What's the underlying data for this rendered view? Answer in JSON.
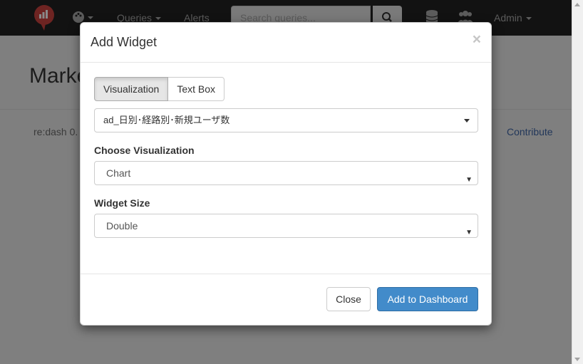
{
  "navbar": {
    "queries_label": "Queries",
    "alerts_label": "Alerts",
    "search_placeholder": "Search queries...",
    "admin_label": "Admin"
  },
  "page": {
    "title": "Marke",
    "footer_version": "re:dash 0.",
    "footer_link": "Contribute"
  },
  "modal": {
    "title": "Add Widget",
    "close_glyph": "×",
    "tabs": [
      {
        "label": "Visualization",
        "active": true
      },
      {
        "label": "Text Box",
        "active": false
      }
    ],
    "query_selected": "ad_日別･経路別･新規ユーザ数",
    "choose_visualization": {
      "label": "Choose Visualization",
      "value": "Chart"
    },
    "widget_size": {
      "label": "Widget Size",
      "value": "Double"
    },
    "buttons": {
      "close": "Close",
      "add": "Add to Dashboard"
    }
  },
  "colors": {
    "primary": "#428bca",
    "logo": "#d9534f"
  }
}
